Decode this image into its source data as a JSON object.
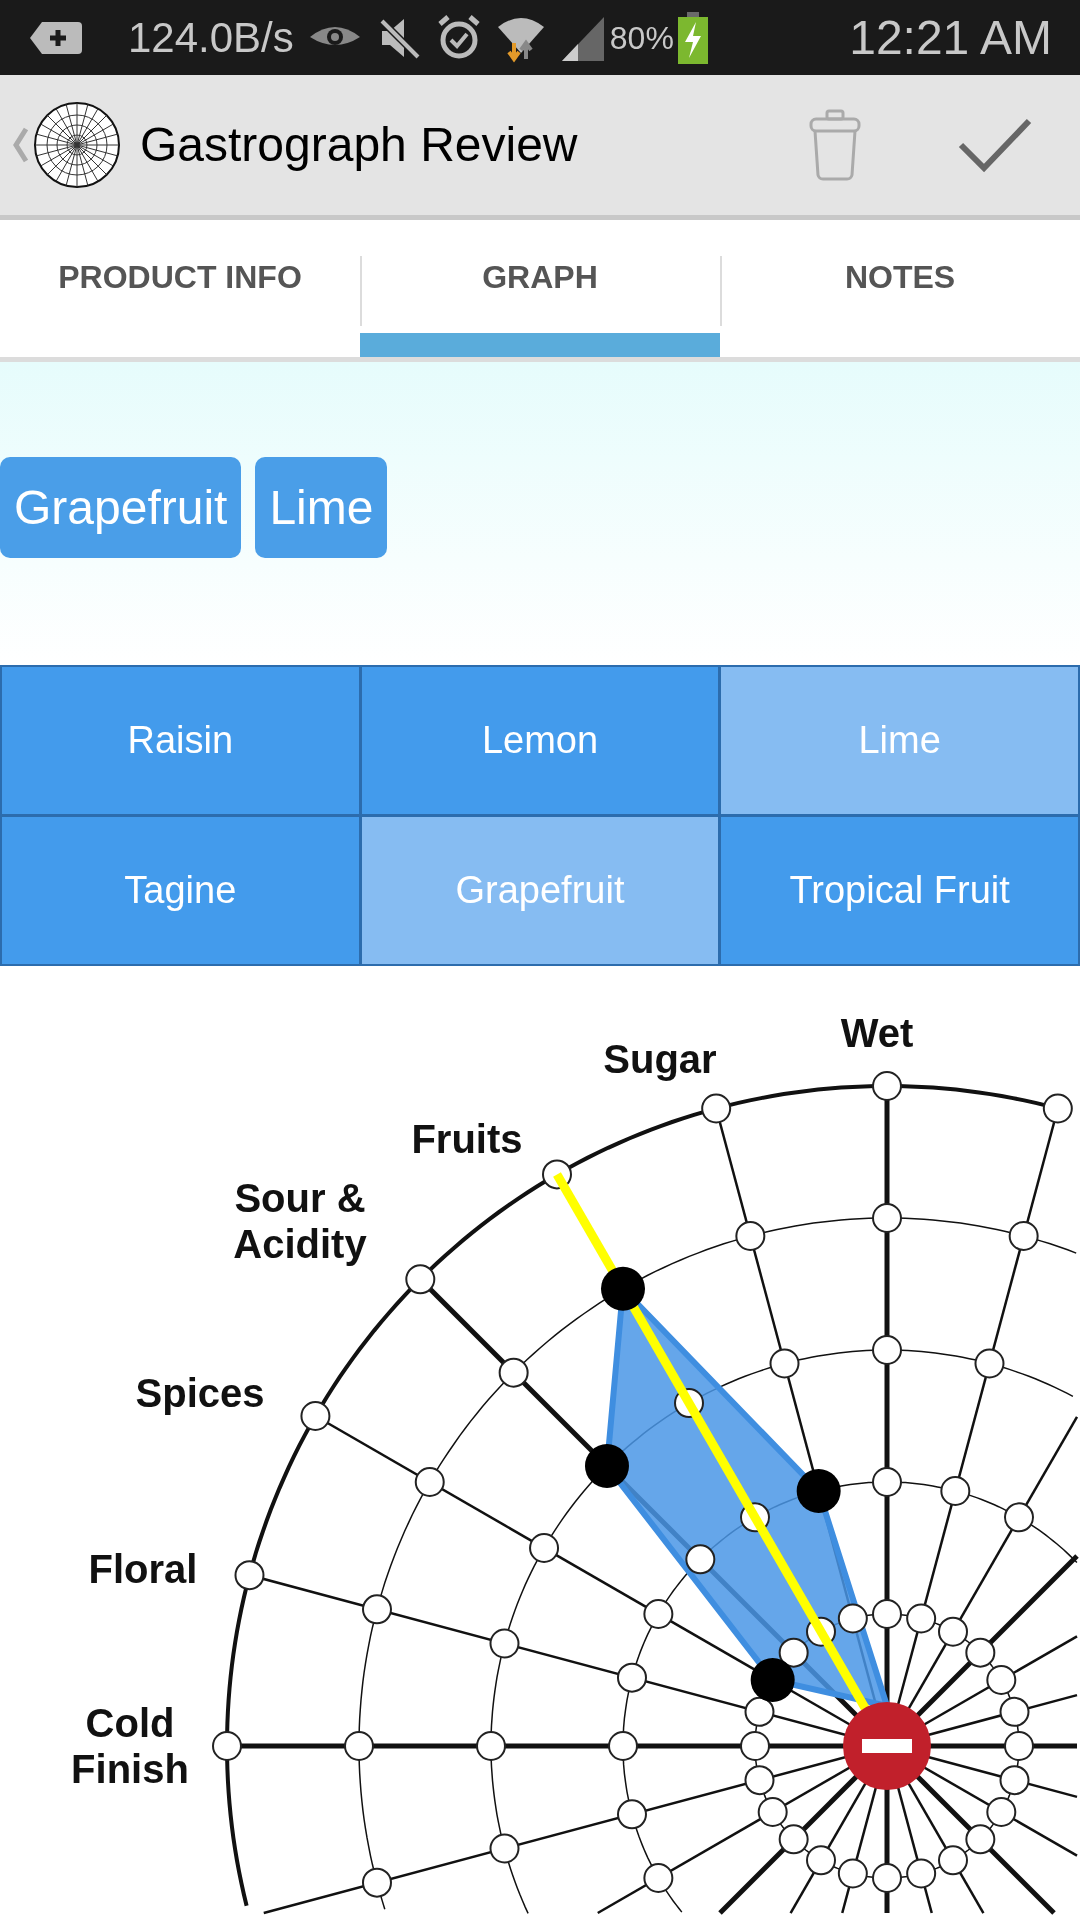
{
  "status_bar": {
    "speed": "124.0B/s",
    "battery": "80%",
    "time": "12:21 AM"
  },
  "action_bar": {
    "title": "Gastrograph Review"
  },
  "tabs": [
    {
      "label": "PRODUCT INFO",
      "selected": false
    },
    {
      "label": "GRAPH",
      "selected": true
    },
    {
      "label": "NOTES",
      "selected": false
    }
  ],
  "chips": [
    "Grapefruit",
    "Lime"
  ],
  "flavors": [
    {
      "label": "Raisin",
      "selected": false
    },
    {
      "label": "Lemon",
      "selected": false
    },
    {
      "label": "Lime",
      "selected": true
    },
    {
      "label": "Tagine",
      "selected": false
    },
    {
      "label": "Grapefruit",
      "selected": true
    },
    {
      "label": "Tropical Fruit",
      "selected": false
    }
  ],
  "graph": {
    "axis_labels": [
      "Wet",
      "Sugar",
      "Fruits",
      "Sour & Acidity",
      "Spices",
      "Floral",
      "Cold Finish"
    ]
  }
}
